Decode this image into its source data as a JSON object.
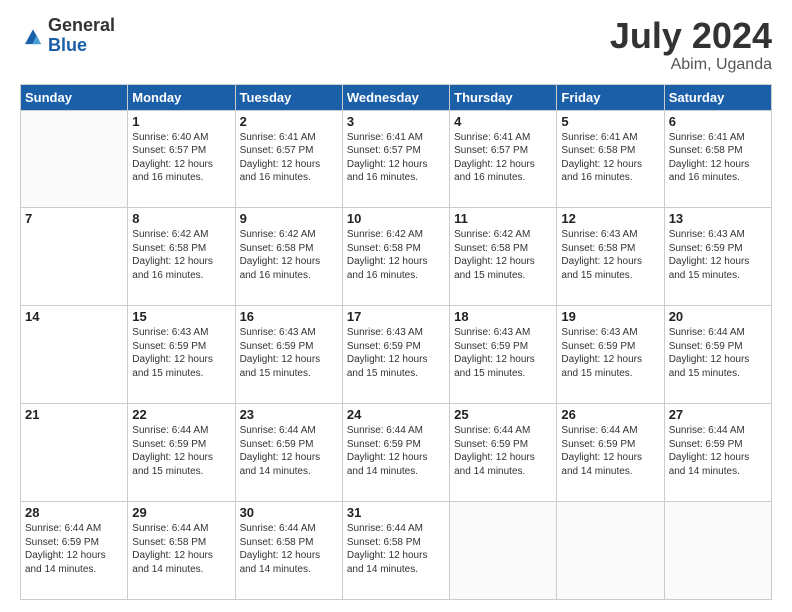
{
  "logo": {
    "general": "General",
    "blue": "Blue"
  },
  "header": {
    "month": "July 2024",
    "location": "Abim, Uganda"
  },
  "weekdays": [
    "Sunday",
    "Monday",
    "Tuesday",
    "Wednesday",
    "Thursday",
    "Friday",
    "Saturday"
  ],
  "weeks": [
    [
      {
        "day": "",
        "detail": ""
      },
      {
        "day": "1",
        "detail": "Sunrise: 6:40 AM\nSunset: 6:57 PM\nDaylight: 12 hours and 16 minutes."
      },
      {
        "day": "2",
        "detail": "Sunrise: 6:41 AM\nSunset: 6:57 PM\nDaylight: 12 hours and 16 minutes."
      },
      {
        "day": "3",
        "detail": "Sunrise: 6:41 AM\nSunset: 6:57 PM\nDaylight: 12 hours and 16 minutes."
      },
      {
        "day": "4",
        "detail": "Sunrise: 6:41 AM\nSunset: 6:57 PM\nDaylight: 12 hours and 16 minutes."
      },
      {
        "day": "5",
        "detail": "Sunrise: 6:41 AM\nSunset: 6:58 PM\nDaylight: 12 hours and 16 minutes."
      },
      {
        "day": "6",
        "detail": "Sunrise: 6:41 AM\nSunset: 6:58 PM\nDaylight: 12 hours and 16 minutes."
      }
    ],
    [
      {
        "day": "7",
        "detail": ""
      },
      {
        "day": "8",
        "detail": "Sunrise: 6:42 AM\nSunset: 6:58 PM\nDaylight: 12 hours and 16 minutes."
      },
      {
        "day": "9",
        "detail": "Sunrise: 6:42 AM\nSunset: 6:58 PM\nDaylight: 12 hours and 16 minutes."
      },
      {
        "day": "10",
        "detail": "Sunrise: 6:42 AM\nSunset: 6:58 PM\nDaylight: 12 hours and 16 minutes."
      },
      {
        "day": "11",
        "detail": "Sunrise: 6:42 AM\nSunset: 6:58 PM\nDaylight: 12 hours and 15 minutes."
      },
      {
        "day": "12",
        "detail": "Sunrise: 6:43 AM\nSunset: 6:58 PM\nDaylight: 12 hours and 15 minutes."
      },
      {
        "day": "13",
        "detail": "Sunrise: 6:43 AM\nSunset: 6:59 PM\nDaylight: 12 hours and 15 minutes."
      }
    ],
    [
      {
        "day": "14",
        "detail": ""
      },
      {
        "day": "15",
        "detail": "Sunrise: 6:43 AM\nSunset: 6:59 PM\nDaylight: 12 hours and 15 minutes."
      },
      {
        "day": "16",
        "detail": "Sunrise: 6:43 AM\nSunset: 6:59 PM\nDaylight: 12 hours and 15 minutes."
      },
      {
        "day": "17",
        "detail": "Sunrise: 6:43 AM\nSunset: 6:59 PM\nDaylight: 12 hours and 15 minutes."
      },
      {
        "day": "18",
        "detail": "Sunrise: 6:43 AM\nSunset: 6:59 PM\nDaylight: 12 hours and 15 minutes."
      },
      {
        "day": "19",
        "detail": "Sunrise: 6:43 AM\nSunset: 6:59 PM\nDaylight: 12 hours and 15 minutes."
      },
      {
        "day": "20",
        "detail": "Sunrise: 6:44 AM\nSunset: 6:59 PM\nDaylight: 12 hours and 15 minutes."
      }
    ],
    [
      {
        "day": "21",
        "detail": ""
      },
      {
        "day": "22",
        "detail": "Sunrise: 6:44 AM\nSunset: 6:59 PM\nDaylight: 12 hours and 15 minutes."
      },
      {
        "day": "23",
        "detail": "Sunrise: 6:44 AM\nSunset: 6:59 PM\nDaylight: 12 hours and 14 minutes."
      },
      {
        "day": "24",
        "detail": "Sunrise: 6:44 AM\nSunset: 6:59 PM\nDaylight: 12 hours and 14 minutes."
      },
      {
        "day": "25",
        "detail": "Sunrise: 6:44 AM\nSunset: 6:59 PM\nDaylight: 12 hours and 14 minutes."
      },
      {
        "day": "26",
        "detail": "Sunrise: 6:44 AM\nSunset: 6:59 PM\nDaylight: 12 hours and 14 minutes."
      },
      {
        "day": "27",
        "detail": "Sunrise: 6:44 AM\nSunset: 6:59 PM\nDaylight: 12 hours and 14 minutes."
      }
    ],
    [
      {
        "day": "28",
        "detail": "Sunrise: 6:44 AM\nSunset: 6:59 PM\nDaylight: 12 hours and 14 minutes."
      },
      {
        "day": "29",
        "detail": "Sunrise: 6:44 AM\nSunset: 6:58 PM\nDaylight: 12 hours and 14 minutes."
      },
      {
        "day": "30",
        "detail": "Sunrise: 6:44 AM\nSunset: 6:58 PM\nDaylight: 12 hours and 14 minutes."
      },
      {
        "day": "31",
        "detail": "Sunrise: 6:44 AM\nSunset: 6:58 PM\nDaylight: 12 hours and 14 minutes."
      },
      {
        "day": "",
        "detail": ""
      },
      {
        "day": "",
        "detail": ""
      },
      {
        "day": "",
        "detail": ""
      }
    ]
  ]
}
